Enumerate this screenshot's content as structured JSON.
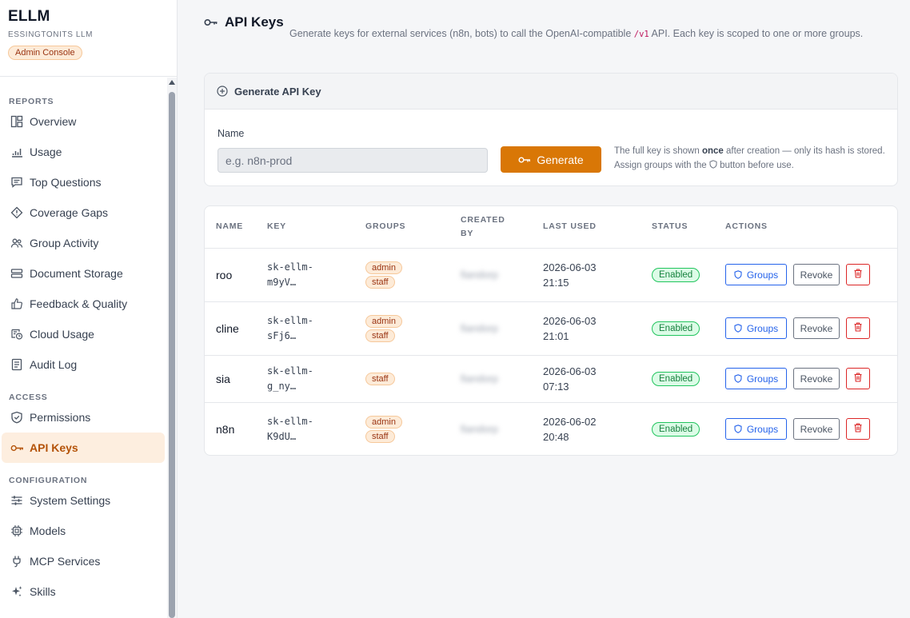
{
  "brand": {
    "title": "ELLM",
    "subtitle": "ESSINGTONITS LLM",
    "badge": "Admin Console"
  },
  "sidebar": {
    "sections": [
      {
        "title": "REPORTS",
        "items": [
          {
            "label": "Overview",
            "icon": "layout-icon"
          },
          {
            "label": "Usage",
            "icon": "bar-chart-icon"
          },
          {
            "label": "Top Questions",
            "icon": "message-icon"
          },
          {
            "label": "Coverage Gaps",
            "icon": "alert-diamond-icon"
          },
          {
            "label": "Group Activity",
            "icon": "users-icon"
          },
          {
            "label": "Document Storage",
            "icon": "storage-icon"
          },
          {
            "label": "Feedback & Quality",
            "icon": "thumbs-up-icon"
          },
          {
            "label": "Cloud Usage",
            "icon": "cloud-usage-icon"
          },
          {
            "label": "Audit Log",
            "icon": "file-list-icon"
          }
        ]
      },
      {
        "title": "ACCESS",
        "items": [
          {
            "label": "Permissions",
            "icon": "shield-check-icon"
          },
          {
            "label": "API Keys",
            "icon": "key-icon",
            "active": true
          }
        ]
      },
      {
        "title": "CONFIGURATION",
        "items": [
          {
            "label": "System Settings",
            "icon": "sliders-icon"
          },
          {
            "label": "Models",
            "icon": "cpu-icon"
          },
          {
            "label": "MCP Services",
            "icon": "plug-icon"
          },
          {
            "label": "Skills",
            "icon": "sparkles-icon"
          }
        ]
      }
    ]
  },
  "page": {
    "title": "API Keys",
    "description_before": "Generate keys for external services (n8n, bots) to call the OpenAI-compatible ",
    "description_code": "/v1",
    "description_after": " API. Each key is scoped to one or more groups."
  },
  "generate": {
    "header": "Generate API Key",
    "name_label": "Name",
    "name_placeholder": "e.g. n8n-prod",
    "name_value": "",
    "button_label": "Generate",
    "note_before": "The full key is shown ",
    "note_bold": "once",
    "note_after": " after creation — only its hash is stored. Assign groups with the",
    "note_end": "button before use."
  },
  "table": {
    "columns": {
      "name": "NAME",
      "key": "KEY",
      "groups": "GROUPS",
      "created_by_1": "CREATED",
      "created_by_2": "BY",
      "last_used": "LAST USED",
      "status": "STATUS",
      "actions": "ACTIONS"
    },
    "action_labels": {
      "groups": "Groups",
      "revoke": "Revoke"
    },
    "rows": [
      {
        "name": "roo",
        "key_1": "sk-ellm-",
        "key_2": "m9yV…",
        "groups": [
          "admin",
          "staff"
        ],
        "created_by": "fiandorp",
        "date_1": "2026-06-03",
        "date_2": "21:15",
        "status": "Enabled"
      },
      {
        "name": "cline",
        "key_1": "sk-ellm-",
        "key_2": "sFj6…",
        "groups": [
          "admin",
          "staff"
        ],
        "created_by": "fiandorp",
        "date_1": "2026-06-03",
        "date_2": "21:01",
        "status": "Enabled"
      },
      {
        "name": "sia",
        "key_1": "sk-ellm-",
        "key_2": "g_ny…",
        "groups": [
          "staff"
        ],
        "created_by": "fiandorp",
        "date_1": "2026-06-03",
        "date_2": "07:13",
        "status": "Enabled"
      },
      {
        "name": "n8n",
        "key_1": "sk-ellm-",
        "key_2": "K9dU…",
        "groups": [
          "admin",
          "staff"
        ],
        "created_by": "fiandorp",
        "date_1": "2026-06-02",
        "date_2": "20:48",
        "status": "Enabled"
      }
    ]
  },
  "colors": {
    "accent": "#d97706",
    "active_nav_bg": "#fdeedf",
    "status_green": "#15803d",
    "link_blue": "#2563eb",
    "danger_red": "#dc2626"
  }
}
